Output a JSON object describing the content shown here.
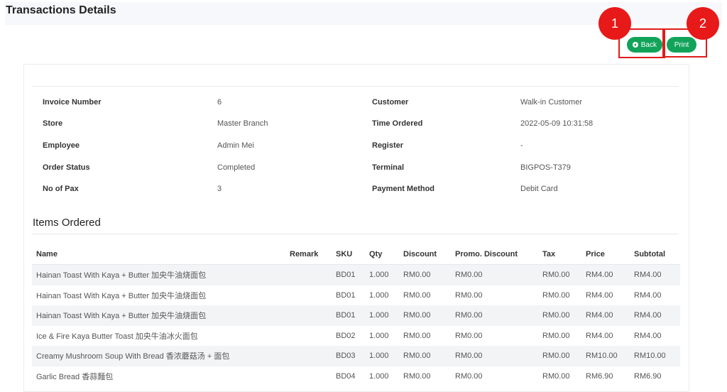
{
  "page": {
    "title": "Transactions Details"
  },
  "buttons": {
    "back_label": "Back",
    "print_label": "Print"
  },
  "annotations": {
    "badge1": "1",
    "badge2": "2",
    "color": "#e81919"
  },
  "accent_color": "#12a35a",
  "details": {
    "left": [
      {
        "label": "Invoice Number",
        "value": "6"
      },
      {
        "label": "Store",
        "value": "Master Branch"
      },
      {
        "label": "Employee",
        "value": "Admin Mei"
      },
      {
        "label": "Order Status",
        "value": "Completed"
      },
      {
        "label": "No of Pax",
        "value": "3"
      }
    ],
    "right": [
      {
        "label": "Customer",
        "value": "Walk-in Customer"
      },
      {
        "label": "Time Ordered",
        "value": "2022-05-09 10:31:58"
      },
      {
        "label": "Register",
        "value": "-"
      },
      {
        "label": "Terminal",
        "value": "BIGPOS-T379"
      },
      {
        "label": "Payment Method",
        "value": "Debit Card"
      }
    ]
  },
  "items": {
    "title": "Items Ordered",
    "headers": [
      "Name",
      "Remark",
      "SKU",
      "Qty",
      "Discount",
      "Promo. Discount",
      "Tax",
      "Price",
      "Subtotal"
    ],
    "rows": [
      [
        "Hainan Toast With Kaya + Butter 加央牛油烧面包",
        "",
        "BD01",
        "1.000",
        "RM0.00",
        "RM0.00",
        "RM0.00",
        "RM4.00",
        "RM4.00"
      ],
      [
        "Hainan Toast With Kaya + Butter 加央牛油烧面包",
        "",
        "BD01",
        "1.000",
        "RM0.00",
        "RM0.00",
        "RM0.00",
        "RM4.00",
        "RM4.00"
      ],
      [
        "Hainan Toast With Kaya + Butter 加央牛油烧面包",
        "",
        "BD01",
        "1.000",
        "RM0.00",
        "RM0.00",
        "RM0.00",
        "RM4.00",
        "RM4.00"
      ],
      [
        "Ice & Fire Kaya Butter Toast 加央牛油冰火面包",
        "",
        "BD02",
        "1.000",
        "RM0.00",
        "RM0.00",
        "RM0.00",
        "RM4.00",
        "RM4.00"
      ],
      [
        "Creamy Mushroom Soup With Bread 香浓蘑菇汤 + 面包",
        "",
        "BD03",
        "1.000",
        "RM0.00",
        "RM0.00",
        "RM0.00",
        "RM10.00",
        "RM10.00"
      ],
      [
        "Garlic Bread 香蒜麵包",
        "",
        "BD04",
        "1.000",
        "RM0.00",
        "RM0.00",
        "RM0.00",
        "RM6.90",
        "RM6.90"
      ]
    ]
  }
}
